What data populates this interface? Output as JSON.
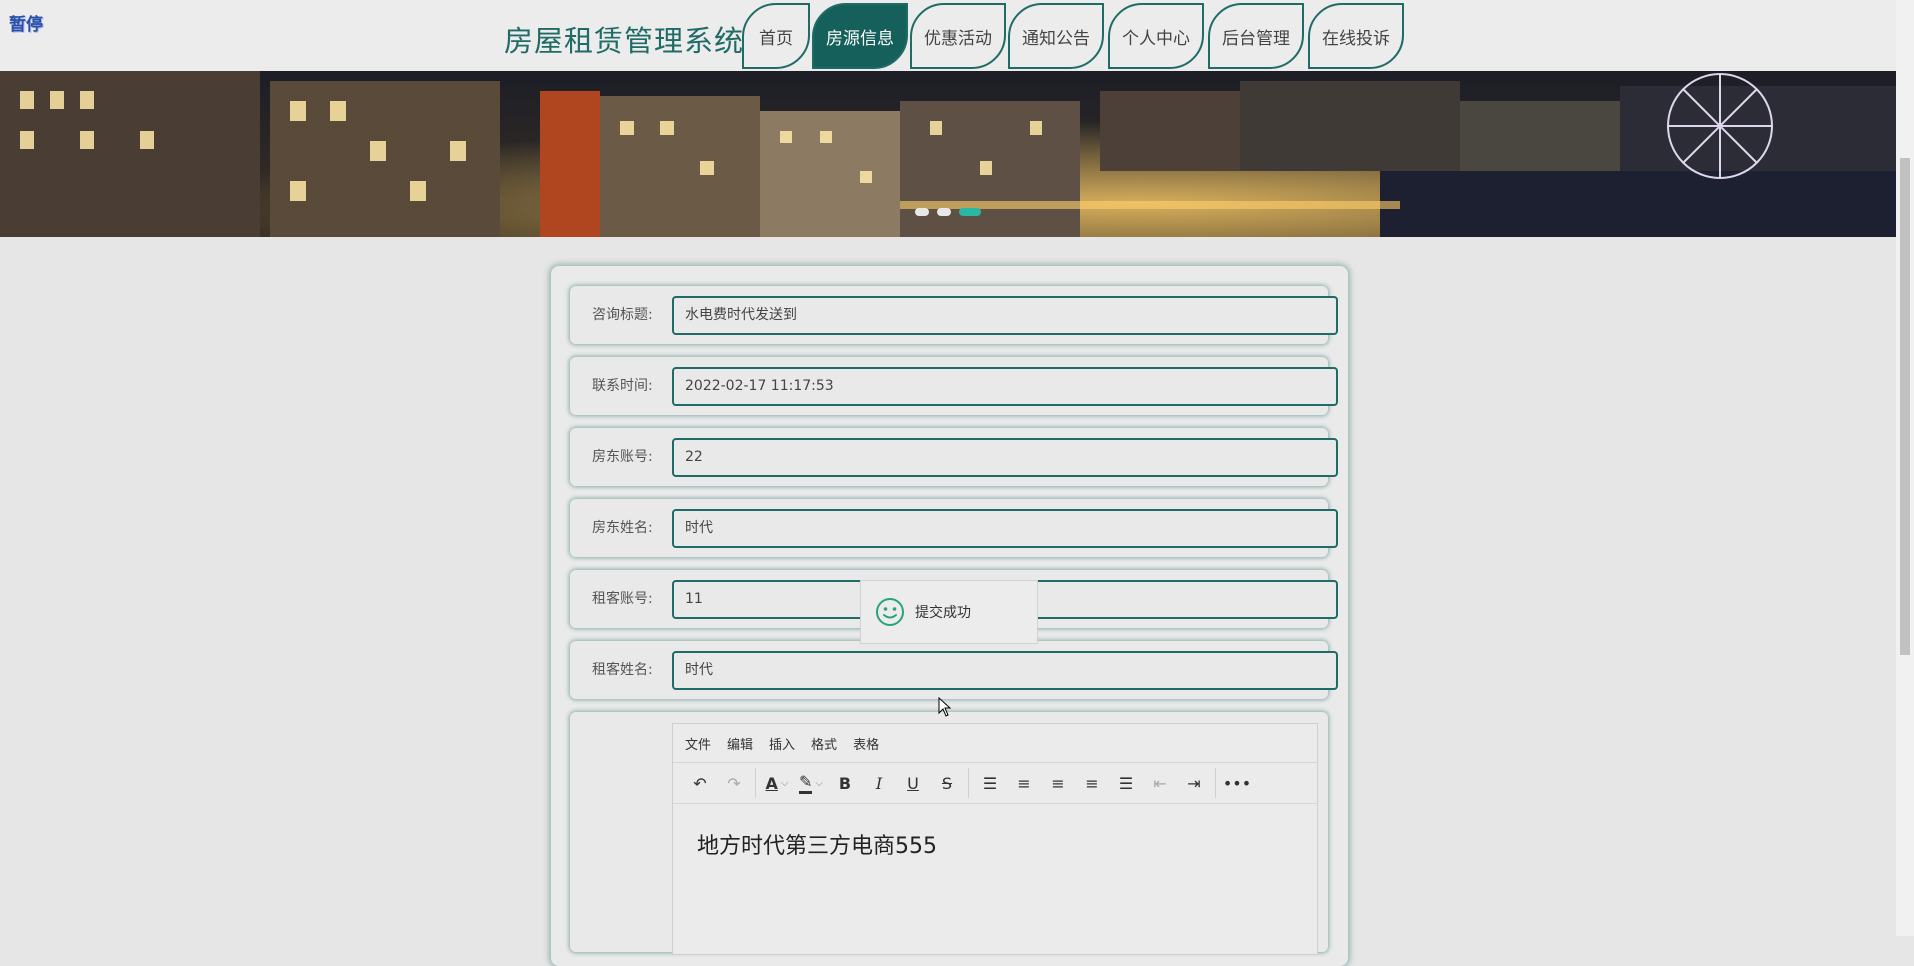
{
  "header": {
    "pause_badge": "暂停",
    "site_title": "房屋租赁管理系统",
    "nav": [
      {
        "label": "首页",
        "active": false
      },
      {
        "label": "房源信息",
        "active": true
      },
      {
        "label": "优惠活动",
        "active": false
      },
      {
        "label": "通知公告",
        "active": false
      },
      {
        "label": "个人中心",
        "active": false
      },
      {
        "label": "后台管理",
        "active": false
      },
      {
        "label": "在线投诉",
        "active": false
      }
    ]
  },
  "banner": {
    "slides": 3,
    "active_slide": 3
  },
  "form": {
    "fields": [
      {
        "label": "咨询标题:",
        "value": "水电费时代发送到"
      },
      {
        "label": "联系时间:",
        "value": "2022-02-17 11:17:53"
      },
      {
        "label": "房东账号:",
        "value": "22"
      },
      {
        "label": "房东姓名:",
        "value": "时代"
      },
      {
        "label": "租客账号:",
        "value": "11"
      },
      {
        "label": "租客姓名:",
        "value": "时代"
      }
    ],
    "editor": {
      "menus": [
        "文件",
        "编辑",
        "插入",
        "格式",
        "表格"
      ],
      "content": "地方时代第三方电商555"
    }
  },
  "toast": {
    "message": "提交成功",
    "icon": "smile-icon"
  },
  "colors": {
    "accent": "#1f6b66",
    "nav_active": "#15605b",
    "dot_active": "#28b8a4"
  }
}
